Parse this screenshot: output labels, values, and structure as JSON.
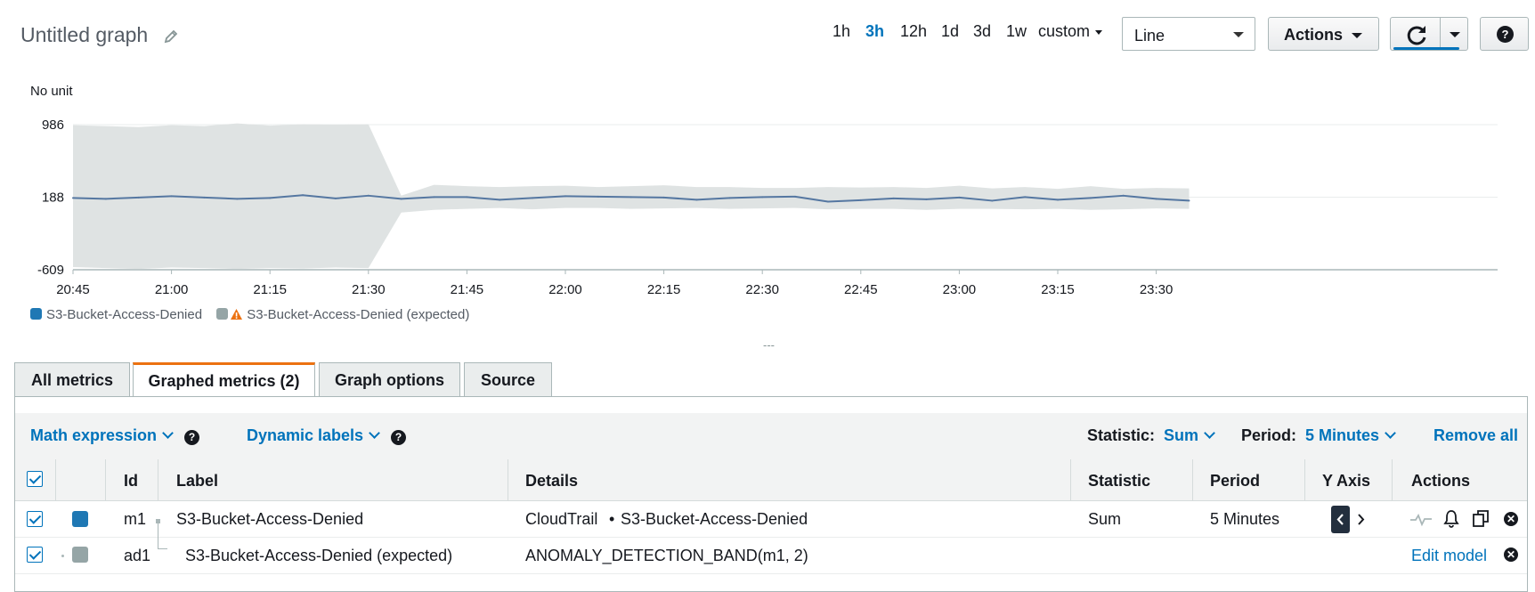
{
  "header": {
    "title": "Untitled graph",
    "time_ranges": [
      "1h",
      "3h",
      "12h",
      "1d",
      "3d",
      "1w"
    ],
    "active_range": "3h",
    "custom_label": "custom",
    "chart_type": "Line",
    "actions_label": "Actions",
    "help_label": "?"
  },
  "chart_data": {
    "type": "line",
    "ylabel": "No unit",
    "yticks": [
      "986",
      "188",
      "-609"
    ],
    "ylim": [
      -609,
      986
    ],
    "xticks": [
      "20:45",
      "21:00",
      "21:15",
      "21:30",
      "21:45",
      "22:00",
      "22:15",
      "22:30",
      "22:45",
      "23:00",
      "23:15",
      "23:30"
    ],
    "grid": true,
    "series": [
      {
        "name": "S3-Bucket-Access-Denied",
        "color": "#5577a1",
        "anomaly_color": "#d13212",
        "x": [
          "20:45",
          "20:50",
          "20:55",
          "21:00",
          "21:05",
          "21:10",
          "21:15",
          "21:20",
          "21:25",
          "21:30",
          "21:35",
          "21:40",
          "21:45",
          "21:50",
          "21:55",
          "22:00",
          "22:05",
          "22:10",
          "22:15",
          "22:20",
          "22:25",
          "22:30",
          "22:35",
          "22:40",
          "22:45",
          "22:50",
          "22:55",
          "23:00",
          "23:05",
          "23:10",
          "23:15",
          "23:20",
          "23:25",
          "23:30",
          "23:35"
        ],
        "values": [
          180,
          170,
          185,
          200,
          185,
          170,
          180,
          210,
          175,
          205,
          170,
          190,
          190,
          160,
          180,
          200,
          195,
          190,
          185,
          160,
          180,
          190,
          195,
          140,
          155,
          175,
          165,
          185,
          150,
          190,
          160,
          180,
          205,
          170,
          150
        ]
      },
      {
        "name": "S3-Bucket-Access-Denied (expected)",
        "color": "#dfe3e3",
        "type": "band",
        "upper": [
          980,
          970,
          960,
          980,
          970,
          1000,
          975,
          990,
          985,
          990,
          205,
          325,
          310,
          300,
          310,
          315,
          300,
          310,
          320,
          300,
          300,
          290,
          290,
          300,
          295,
          300,
          290,
          315,
          285,
          300,
          280,
          310,
          280,
          290,
          285
        ],
        "lower": [
          -580,
          -590,
          -600,
          -585,
          -590,
          -600,
          -590,
          -595,
          -585,
          -590,
          20,
          50,
          60,
          70,
          55,
          70,
          70,
          60,
          65,
          70,
          60,
          65,
          70,
          55,
          60,
          60,
          50,
          60,
          60,
          55,
          60,
          50,
          55,
          65,
          60
        ]
      }
    ],
    "legend": [
      "S3-Bucket-Access-Denied",
      "S3-Bucket-Access-Denied (expected)"
    ]
  },
  "tabs": [
    "All metrics",
    "Graphed metrics (2)",
    "Graph options",
    "Source"
  ],
  "toolbar": {
    "math_expression": "Math expression",
    "dynamic_labels": "Dynamic labels",
    "statistic_label": "Statistic:",
    "statistic_value": "Sum",
    "period_label": "Period:",
    "period_value": "5 Minutes",
    "remove_all": "Remove all"
  },
  "table": {
    "headers": [
      "Id",
      "Label",
      "Details",
      "Statistic",
      "Period",
      "Y Axis",
      "Actions"
    ],
    "rows": [
      {
        "id": "m1",
        "label": "S3-Bucket-Access-Denied",
        "details_ns": "CloudTrail",
        "details_sep": "•",
        "details_metric": "S3-Bucket-Access-Denied",
        "statistic": "Sum",
        "period": "5 Minutes",
        "color": "#1f78b4"
      },
      {
        "id": "ad1",
        "label": "S3-Bucket-Access-Denied (expected)",
        "details": "ANOMALY_DETECTION_BAND(m1, 2)",
        "action_link": "Edit model",
        "color": "#95a5a6"
      }
    ]
  }
}
